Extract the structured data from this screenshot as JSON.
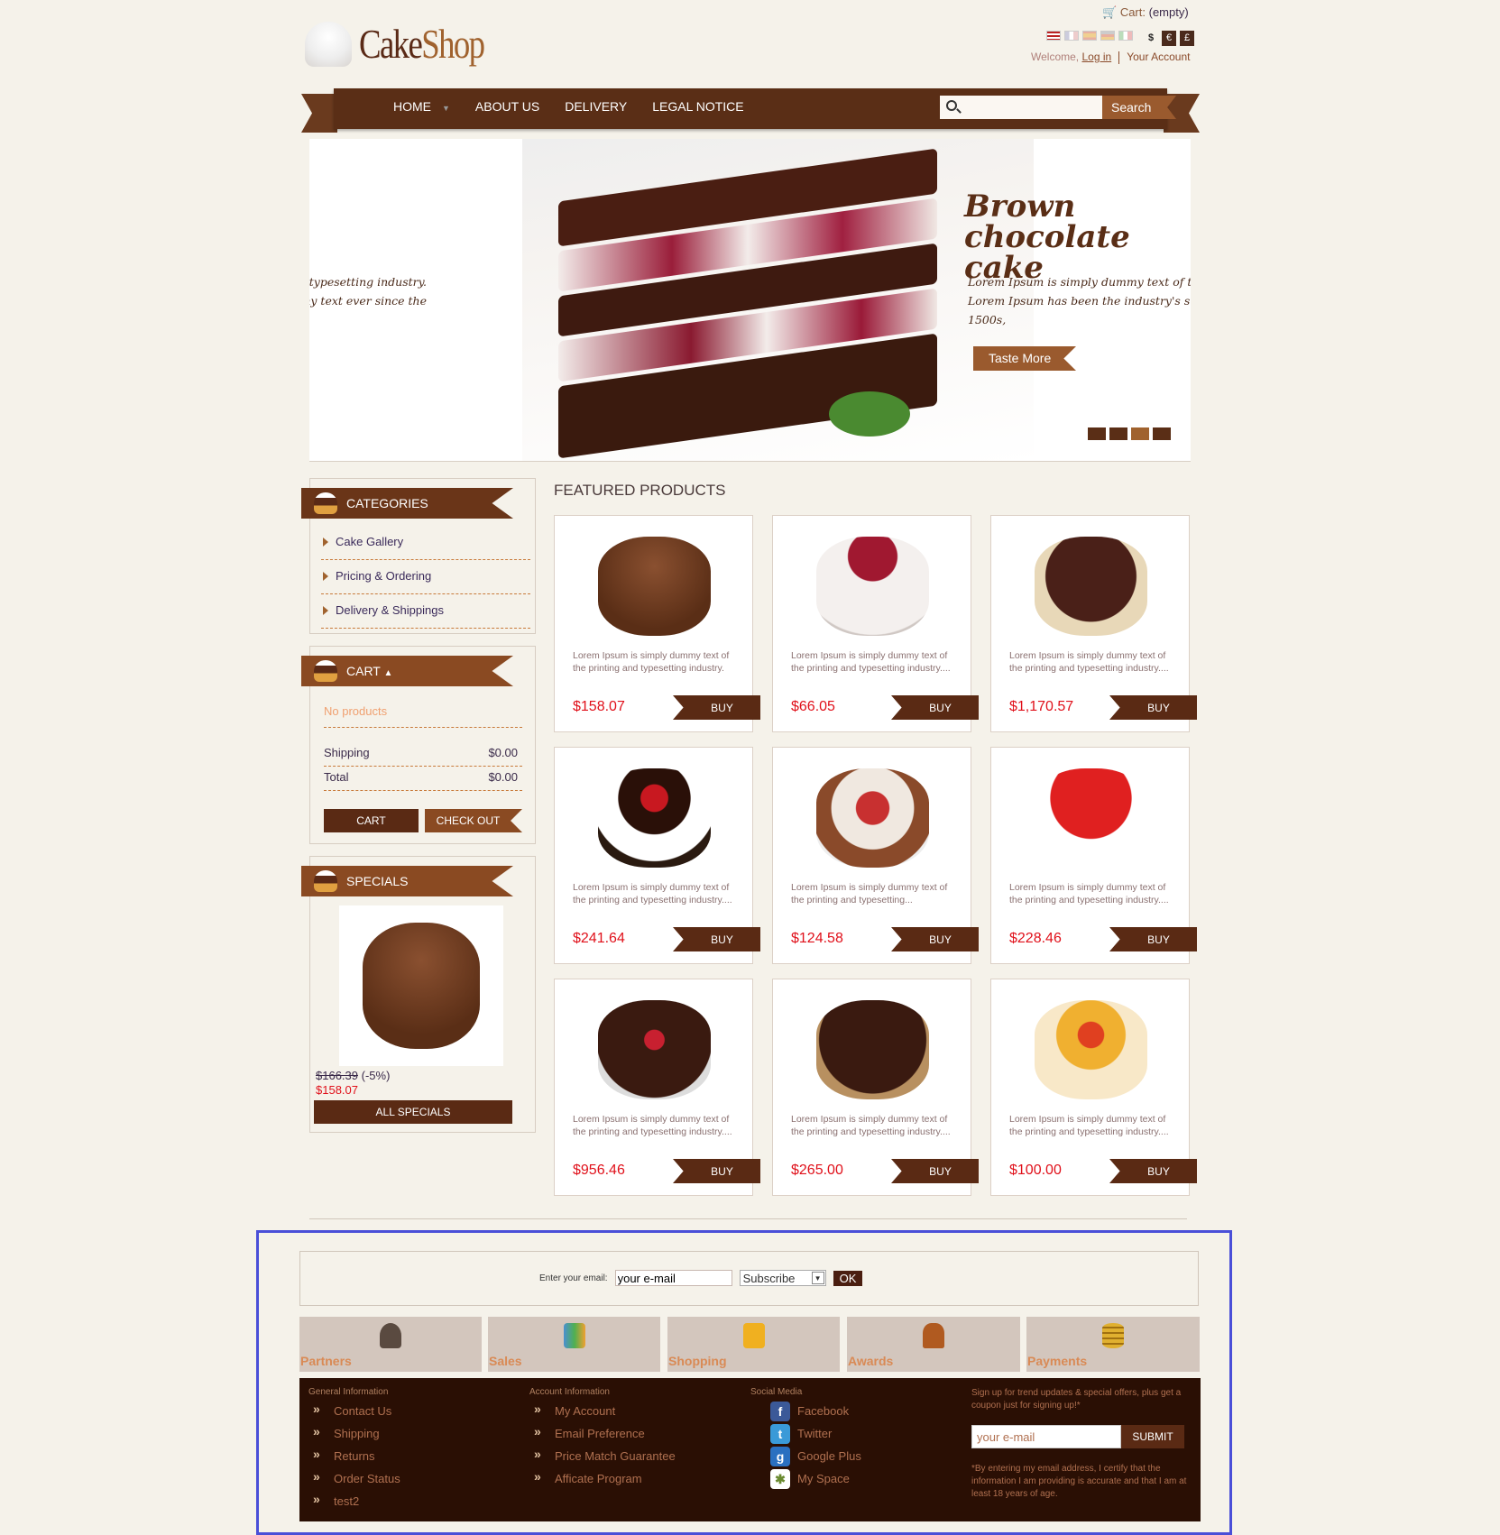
{
  "header": {
    "cart_label": "Cart:",
    "cart_status": "(empty)",
    "languages": [
      "English",
      "French",
      "Spanish",
      "German",
      "Italian"
    ],
    "currencies": [
      "$",
      "€",
      "£"
    ],
    "welcome": "Welcome,",
    "login": "Log in",
    "your_account": "Your Account",
    "logo_part1": "Cake",
    "logo_part2": "Shop"
  },
  "nav": {
    "items": [
      "HOME",
      "ABOUT US",
      "DELIVERY",
      "LEGAL NOTICE"
    ],
    "search_placeholder": "",
    "search_label": "Search"
  },
  "banner": {
    "prev_line1": "printing and typesetting industry.",
    "prev_line2": "ndard dummy text ever since the",
    "title_line1": "Brown",
    "title_line2": "chocolate cake",
    "text_line1": "Lorem Ipsum is simply dummy text of the",
    "text_line2": "Lorem Ipsum has been the industry's sta",
    "text_line3": "1500s,",
    "cta": "Taste More",
    "slide_count": 4,
    "active_slide": 3
  },
  "sidebar": {
    "categories_title": "CATEGORIES",
    "categories": [
      "Cake Gallery",
      "Pricing & Ordering",
      "Delivery & Shippings"
    ],
    "cart_title": "CART",
    "cart_empty": "No products",
    "shipping_label": "Shipping",
    "shipping_value": "$0.00",
    "total_label": "Total",
    "total_value": "$0.00",
    "cart_button": "CART",
    "checkout_button": "CHECK OUT",
    "specials_title": "SPECIALS",
    "special_old_price": "$166.39",
    "special_discount": "(-5%)",
    "special_price": "$158.07",
    "all_specials": "ALL SPECIALS"
  },
  "featured": {
    "title": "FEATURED PRODUCTS",
    "buy_label": "BUY",
    "products": [
      {
        "desc": "Lorem Ipsum is simply dummy text of the printing and typesetting industry.",
        "price": "$158.07"
      },
      {
        "desc": "Lorem Ipsum is simply dummy text of the printing and typesetting industry....",
        "price": "$66.05"
      },
      {
        "desc": "Lorem Ipsum is simply dummy text of the printing and typesetting industry....",
        "price": "$1,170.57"
      },
      {
        "desc": "Lorem Ipsum is simply dummy text of the printing and typesetting industry....",
        "price": "$241.64"
      },
      {
        "desc": "Lorem Ipsum is simply dummy text of the printing and typesetting...",
        "price": "$124.58"
      },
      {
        "desc": "Lorem Ipsum is simply dummy text of the printing and typesetting industry....",
        "price": "$228.46"
      },
      {
        "desc": "Lorem Ipsum is simply dummy text of the printing and typesetting industry....",
        "price": "$956.46"
      },
      {
        "desc": "Lorem Ipsum is simply dummy text of the printing and typesetting industry....",
        "price": "$265.00"
      },
      {
        "desc": "Lorem Ipsum is simply dummy text of the printing and typesetting industry....",
        "price": "$100.00"
      }
    ]
  },
  "newsletter": {
    "label": "Enter your email:",
    "placeholder": "your e-mail",
    "select_value": "Subscribe",
    "ok": "OK"
  },
  "tiles": [
    "Partners",
    "Sales",
    "Shopping",
    "Awards",
    "Payments"
  ],
  "footer": {
    "general_title": "General Information",
    "general_links": [
      "Contact Us",
      "Shipping",
      "Returns",
      "Order Status",
      "test2"
    ],
    "account_title": "Account Information",
    "account_links": [
      "My Account",
      "Email Preference",
      "Price Match Guarantee",
      "Afficate Program"
    ],
    "social_title": "Social Media",
    "social_links": [
      "Facebook",
      "Twitter",
      "Google Plus",
      "My Space"
    ],
    "signup_text": "Sign up for trend updates & special offers, plus get a coupon just for signing up!*",
    "signup_placeholder": "your e-mail",
    "signup_button": "SUBMIT",
    "signup_legal": "*By entering my email address, I certify that the information I am providing is accurate and that I am at least 18 years of age."
  },
  "colors": {
    "brand_dark": "#5a2e16",
    "brand_light": "#a0622e",
    "price": "#e0101a",
    "footer_bg": "#2a0f04",
    "tile_bg": "#d3c6bd"
  }
}
